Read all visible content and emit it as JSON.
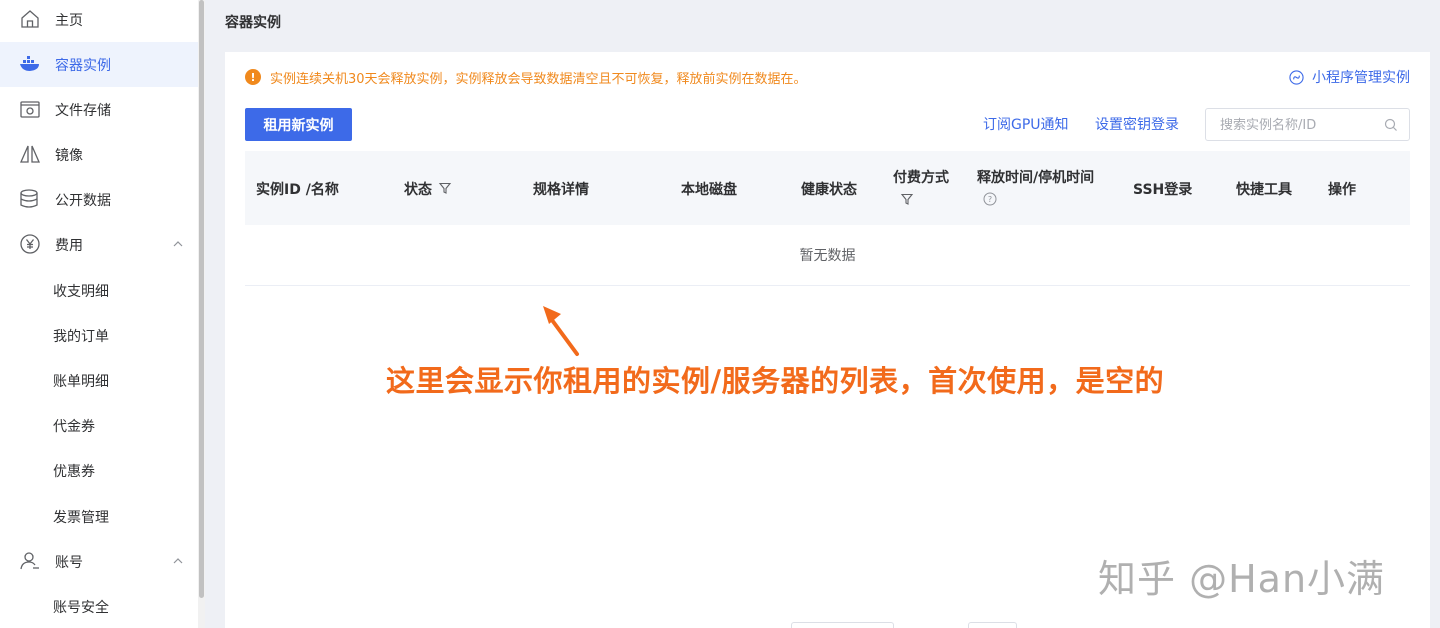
{
  "sidebar": {
    "items": [
      {
        "label": "主页",
        "icon": "home-icon"
      },
      {
        "label": "容器实例",
        "icon": "container-icon",
        "active": true
      },
      {
        "label": "文件存储",
        "icon": "storage-icon"
      },
      {
        "label": "镜像",
        "icon": "mirror-icon"
      },
      {
        "label": "公开数据",
        "icon": "database-icon"
      },
      {
        "label": "费用",
        "icon": "yuan-icon",
        "expanded": true
      },
      {
        "label": "收支明细"
      },
      {
        "label": "我的订单"
      },
      {
        "label": "账单明细"
      },
      {
        "label": "代金券"
      },
      {
        "label": "优惠券"
      },
      {
        "label": "发票管理"
      },
      {
        "label": "账号",
        "icon": "user-icon",
        "expanded": true
      },
      {
        "label": "账号安全"
      }
    ],
    "active_color": "#3d6ae8"
  },
  "page": {
    "title": "容器实例"
  },
  "notice": {
    "text": "实例连续关机30天会释放实例，实例释放会导致数据清空且不可恢复，释放前实例在数据在。",
    "color": "#f0891d"
  },
  "toolbar": {
    "mini_program_link": "小程序管理实例",
    "rent_button": "租用新实例",
    "subscribe_link": "订阅GPU通知",
    "ssh_key_link": "设置密钥登录",
    "search_placeholder": "搜索实例名称/ID",
    "primary_color": "#3d6ae8"
  },
  "table": {
    "columns": [
      "实例ID /名称",
      "状态",
      "规格详情",
      "本地磁盘",
      "健康状态",
      "付费方式",
      "释放时间/停机时间",
      "SSH登录",
      "快捷工具",
      "操作"
    ],
    "empty_text": "暂无数据"
  },
  "annotation": {
    "text": "这里会显示你租用的实例/服务器的列表，首次使用，是空的",
    "color": "#f26a1b"
  },
  "watermark": {
    "text": "知乎 @Han小满"
  }
}
